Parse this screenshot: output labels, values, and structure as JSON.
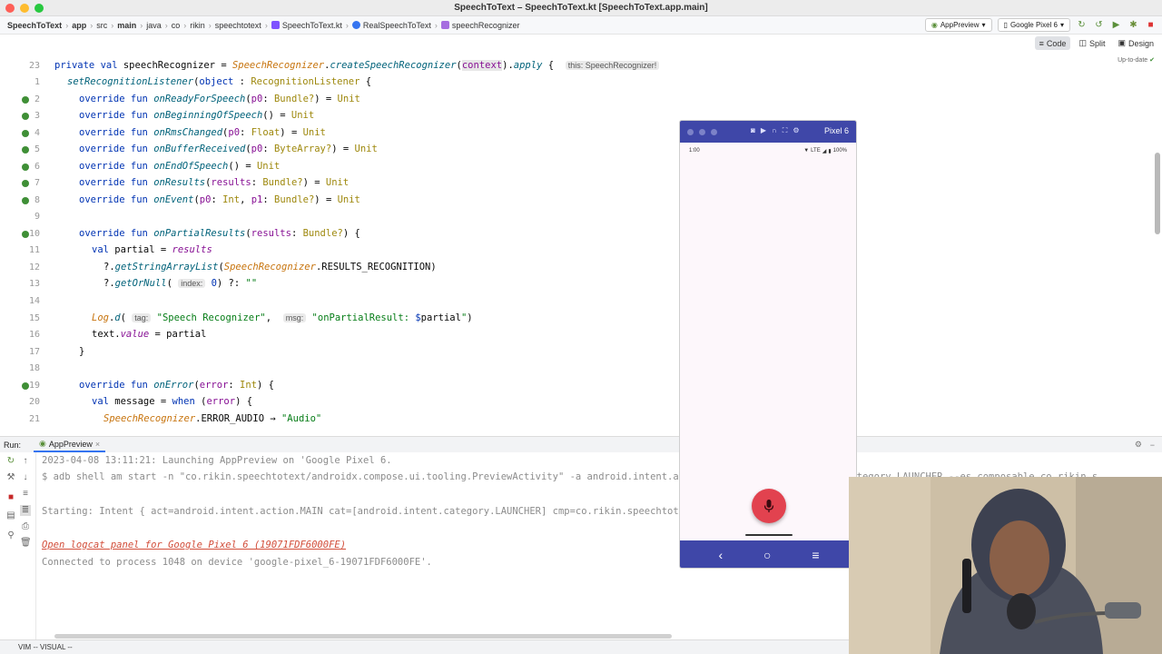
{
  "window": {
    "title": "SpeechToText – SpeechToText.kt [SpeechToText.app.main]"
  },
  "breadcrumbs": [
    "SpeechToText",
    "app",
    "src",
    "main",
    "java",
    "co",
    "rikin",
    "speechtotext",
    "SpeechToText.kt",
    "RealSpeechToText",
    "speechRecognizer"
  ],
  "toolbar": {
    "run_config": "AppPreview",
    "device": "Google Pixel 6"
  },
  "modes": {
    "code": "Code",
    "split": "Split",
    "design": "Design"
  },
  "editor": {
    "status": "Up-to-date",
    "inlay_this": "this: SpeechRecognizer!",
    "hint_index": "index:",
    "hint_tag": "tag:",
    "hint_msg": "msg:",
    "line_numbers": [
      "23",
      "1",
      "2",
      "3",
      "4",
      "5",
      "6",
      "7",
      "8",
      "9",
      "10",
      "11",
      "12",
      "13",
      "14",
      "15",
      "16",
      "17",
      "18",
      "19",
      "20",
      "21"
    ]
  },
  "run": {
    "label": "Run:",
    "tab": "AppPreview",
    "logs": {
      "l1": "2023-04-08 13:11:21: Launching AppPreview on 'Google Pixel 6.",
      "l2": "$ adb shell am start -n \"co.rikin.speechtotext/androidx.compose.ui.tooling.PreviewActivity\" -a android.intent.action.MAIN -c android.intent.category.LAUNCHER --es composable co.rikin.s",
      "l3": "Starting: Intent { act=android.intent.action.MAIN cat=[android.intent.category.LAUNCHER] cmp=co.rikin.speechtotext/androidx.compose.ui.tooling.PreviewActivity (has extras) }",
      "l4": "Open logcat panel for Google Pixel 6 (19071FDF6000FE)",
      "l5": "Connected to process 1048 on device 'google-pixel_6-19071FDF6000FE'."
    }
  },
  "status_bar": {
    "mode": "VIM -- VISUAL --"
  },
  "emulator": {
    "title": "Pixel 6",
    "time": "1:00",
    "signal": "LTE",
    "battery": "100%"
  }
}
